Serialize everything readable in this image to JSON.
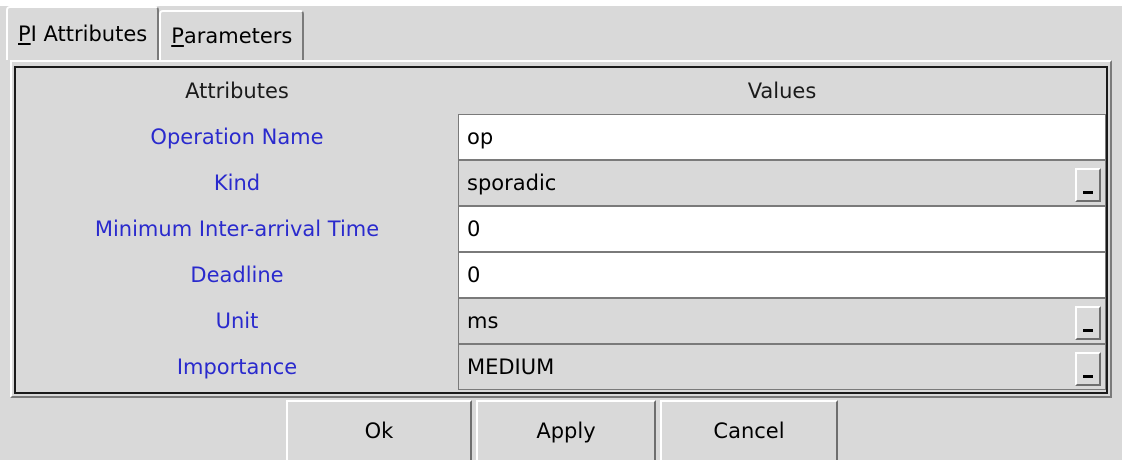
{
  "tabs": [
    {
      "mnemonic": "P",
      "rest": "I Attributes",
      "active": true
    },
    {
      "mnemonic": "P",
      "rest": "arameters",
      "active": false
    }
  ],
  "table": {
    "header_attributes": "Attributes",
    "header_values": "Values",
    "rows": [
      {
        "label": "Operation Name",
        "value": "op",
        "kind": "text"
      },
      {
        "label": "Kind",
        "value": "sporadic",
        "kind": "combo"
      },
      {
        "label": "Minimum Inter-arrival Time",
        "value": "0",
        "kind": "text"
      },
      {
        "label": "Deadline",
        "value": "0",
        "kind": "text"
      },
      {
        "label": "Unit",
        "value": "ms",
        "kind": "combo"
      },
      {
        "label": "Importance",
        "value": "MEDIUM",
        "kind": "combo"
      }
    ]
  },
  "buttons": {
    "ok": "Ok",
    "apply": "Apply",
    "cancel": "Cancel"
  },
  "colors": {
    "background": "#d9d9d9",
    "attribute_label": "#2a2acd",
    "text": "#000000"
  }
}
